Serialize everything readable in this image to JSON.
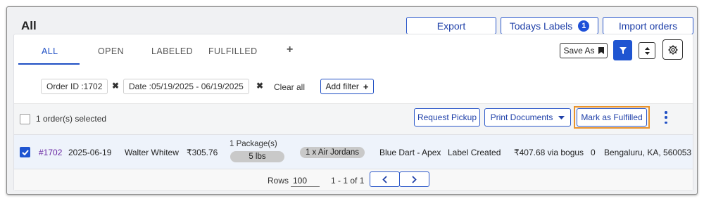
{
  "page": {
    "title": "All"
  },
  "header_actions": {
    "export_label": "Export",
    "todays_labels_label": "Todays Labels",
    "todays_labels_count": "1",
    "import_label": "Import orders"
  },
  "tabs": [
    {
      "label": "ALL",
      "active": true
    },
    {
      "label": "OPEN",
      "active": false
    },
    {
      "label": "LABELED",
      "active": false
    },
    {
      "label": "FULFILLED",
      "active": false
    }
  ],
  "toolbar": {
    "save_as_label": "Save As"
  },
  "filters": {
    "chips": [
      {
        "label": "Order ID :1702"
      },
      {
        "label": "Date :05/19/2025 - 06/19/2025"
      }
    ],
    "clear_all_label": "Clear all",
    "add_filter_label": "Add filter"
  },
  "bulk": {
    "selected_text": "1 order(s) selected",
    "request_pickup_label": "Request Pickup",
    "print_documents_label": "Print Documents",
    "mark_fulfilled_label": "Mark as Fulfilled"
  },
  "orders": [
    {
      "checked": true,
      "order_id": "#1702",
      "date": "2025-06-19",
      "customer": "Walter Whitew",
      "amount": "₹305.76",
      "packages": "1 Package(s)",
      "weight": "5 lbs",
      "items": "1 x Air Jordans",
      "carrier": "Blue Dart - Apex",
      "status": "Label Created",
      "shipping": "₹407.68 via bogus",
      "count": "0",
      "location": "Bengaluru, KA, 560053"
    }
  ],
  "pagination": {
    "rows_label": "Rows",
    "rows_value": "100",
    "range_text": "1 - 1 of 1"
  },
  "colors": {
    "accent": "#1f55d1",
    "highlight_outline": "#e9932c",
    "order_link": "#6b2aa4"
  }
}
